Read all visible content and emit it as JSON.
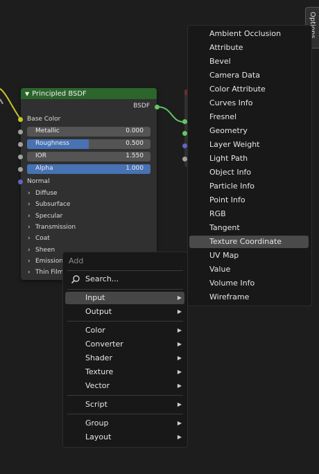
{
  "options_tab": {
    "label": "Options"
  },
  "node": {
    "title": "Principled BSDF",
    "output_label": "BSDF",
    "inputs": {
      "base_color": "Base Color",
      "normal": "Normal"
    },
    "fields": [
      {
        "label": "Metallic",
        "value": "0.000",
        "fill": 0.0
      },
      {
        "label": "Roughness",
        "value": "0.500",
        "fill": 0.5
      },
      {
        "label": "IOR",
        "value": "1.550",
        "fill": 0.0
      },
      {
        "label": "Alpha",
        "value": "1.000",
        "fill": 1.0
      }
    ],
    "panels": [
      "Diffuse",
      "Subsurface",
      "Specular",
      "Transmission",
      "Coat",
      "Sheen",
      "Emission",
      "Thin Film"
    ]
  },
  "add_menu": {
    "title": "Add",
    "search_label": "Search...",
    "items": [
      {
        "label": "Input",
        "submenu": true,
        "active": true
      },
      {
        "label": "Output",
        "submenu": true
      },
      {
        "label": "Color",
        "submenu": true
      },
      {
        "label": "Converter",
        "submenu": true
      },
      {
        "label": "Shader",
        "submenu": true
      },
      {
        "label": "Texture",
        "submenu": true
      },
      {
        "label": "Vector",
        "submenu": true
      },
      {
        "label": "Script",
        "submenu": true
      },
      {
        "label": "Group",
        "submenu": true
      },
      {
        "label": "Layout",
        "submenu": true
      }
    ]
  },
  "input_submenu": {
    "items": [
      "Ambient Occlusion",
      "Attribute",
      "Bevel",
      "Camera Data",
      "Color Attribute",
      "Curves Info",
      "Fresnel",
      "Geometry",
      "Layer Weight",
      "Light Path",
      "Object Info",
      "Particle Info",
      "Point Info",
      "RGB",
      "Tangent",
      "Texture Coordinate",
      "UV Map",
      "Value",
      "Volume Info",
      "Wireframe"
    ],
    "highlighted": "Texture Coordinate"
  },
  "colors": {
    "node_header": "#2b652b",
    "field_fill": "#4772b3",
    "socket_color": "#c7c729",
    "socket_float": "#a1a1a1",
    "socket_vector": "#6363c7",
    "socket_shader": "#63c763"
  }
}
